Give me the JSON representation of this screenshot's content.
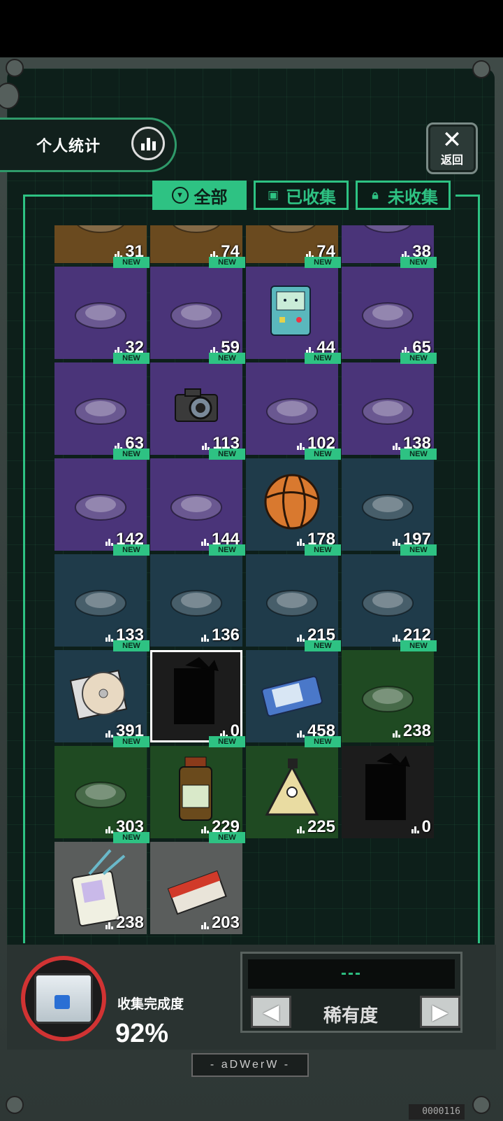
{
  "header": {
    "stats_label": "个人统计",
    "back_label": "返回"
  },
  "tabs": [
    {
      "label": "全部",
      "active": true
    },
    {
      "label": "已收集",
      "active": false
    },
    {
      "label": "未收集",
      "active": false
    }
  ],
  "items": [
    {
      "count": "31",
      "bg": "#6a4a1f",
      "new": false,
      "icon": "wood-crate-icon"
    },
    {
      "count": "74",
      "bg": "#6a4a1f",
      "new": false,
      "icon": "hat-icon"
    },
    {
      "count": "74",
      "bg": "#6a4a1f",
      "new": false,
      "icon": "golden-bread-icon"
    },
    {
      "count": "38",
      "bg": "#4a3479",
      "new": false,
      "icon": "figure-icon"
    },
    {
      "count": "32",
      "bg": "#4a3479",
      "new": true,
      "icon": "stun-gun-icon"
    },
    {
      "count": "59",
      "bg": "#4a3479",
      "new": true,
      "icon": "penguin-squad-icon"
    },
    {
      "count": "44",
      "bg": "#4a3479",
      "new": true,
      "icon": "game-robot-icon"
    },
    {
      "count": "65",
      "bg": "#4a3479",
      "new": true,
      "icon": "wand-icon"
    },
    {
      "count": "63",
      "bg": "#4a3479",
      "new": true,
      "icon": "tiger-scroll-icon"
    },
    {
      "count": "113",
      "bg": "#4a3479",
      "new": true,
      "icon": "camera-icon"
    },
    {
      "count": "102",
      "bg": "#4a3479",
      "new": true,
      "icon": "vr-headset-icon"
    },
    {
      "count": "138",
      "bg": "#4a3479",
      "new": true,
      "icon": "postcard-icon"
    },
    {
      "count": "142",
      "bg": "#4a3479",
      "new": true,
      "icon": "scope-icon"
    },
    {
      "count": "144",
      "bg": "#4a3479",
      "new": true,
      "icon": "keychain-stand-icon"
    },
    {
      "count": "178",
      "bg": "#1f3b4a",
      "new": true,
      "icon": "basketball-icon"
    },
    {
      "count": "197",
      "bg": "#1f3b4a",
      "new": true,
      "icon": "frog-pilot-icon"
    },
    {
      "count": "133",
      "bg": "#1f3b4a",
      "new": true,
      "icon": "hair-dryer-icon"
    },
    {
      "count": "136",
      "bg": "#1f3b4a",
      "new": true,
      "icon": "toothbrush-icon"
    },
    {
      "count": "215",
      "bg": "#1f3b4a",
      "new": true,
      "icon": "glasses-icon"
    },
    {
      "count": "212",
      "bg": "#1f3b4a",
      "new": true,
      "icon": "cd-player-icon"
    },
    {
      "count": "391",
      "bg": "#1f3b4a",
      "new": true,
      "icon": "cd-disc-icon"
    },
    {
      "count": "0",
      "bg": "#1c1c1c",
      "new": false,
      "icon": "unknown-silhouette-icon",
      "selected": true
    },
    {
      "count": "458",
      "bg": "#1f3b4a",
      "new": true,
      "icon": "tablet-icon"
    },
    {
      "count": "238",
      "bg": "#1f4a22",
      "new": true,
      "icon": "jet-icon"
    },
    {
      "count": "303",
      "bg": "#1f4a22",
      "new": true,
      "icon": "helmet-icon"
    },
    {
      "count": "229",
      "bg": "#1f4a22",
      "new": true,
      "icon": "medicine-bottle-icon"
    },
    {
      "count": "225",
      "bg": "#1f4a22",
      "new": true,
      "icon": "triangle-creature-icon"
    },
    {
      "count": "0",
      "bg": "#1c1c1c",
      "new": false,
      "icon": "unknown-silhouette-icon"
    },
    {
      "count": "238",
      "bg": "#5a5d5c",
      "new": true,
      "icon": "id-badge-icon"
    },
    {
      "count": "203",
      "bg": "#5a5d5c",
      "new": true,
      "icon": "cigarette-pack-icon"
    }
  ],
  "new_label": "NEW",
  "footer": {
    "progress_label": "收集完成度",
    "progress_value": "92%",
    "progress_fraction": 0.92,
    "rarity_label": "稀有度",
    "rarity_value": "---",
    "left_arrow": "◀",
    "right_arrow": "▶",
    "plate_text": "- aDWerW -",
    "corner_number": "0000116"
  },
  "colors": {
    "accent": "#2ec283",
    "ring": "#d13333"
  }
}
